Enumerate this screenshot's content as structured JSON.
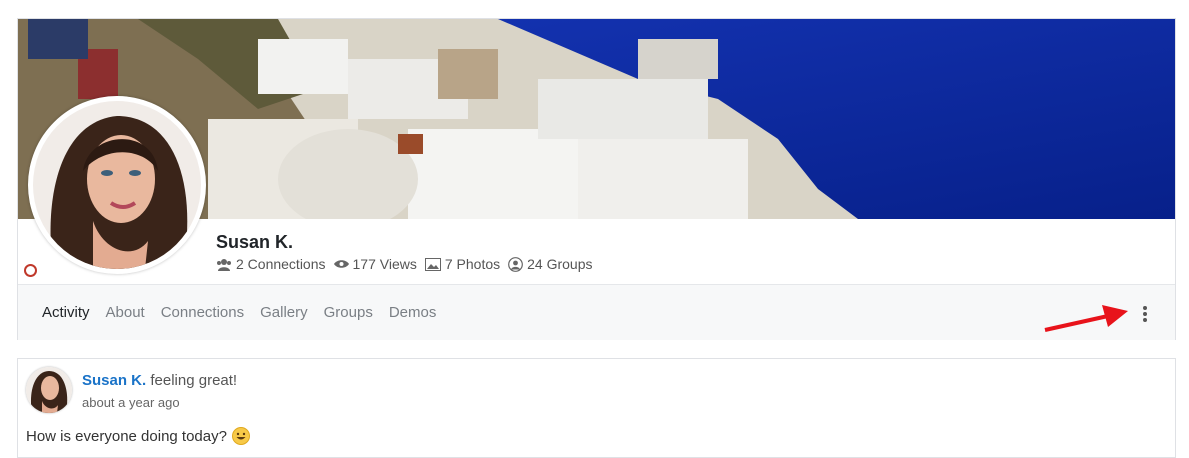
{
  "profile": {
    "name": "Susan K.",
    "stats": {
      "connections": "2 Connections",
      "views": "177 Views",
      "photos": "7 Photos",
      "groups": "24 Groups"
    }
  },
  "tabs": [
    {
      "label": "Activity",
      "active": true
    },
    {
      "label": "About"
    },
    {
      "label": "Connections"
    },
    {
      "label": "Gallery"
    },
    {
      "label": "Groups"
    },
    {
      "label": "Demos"
    }
  ],
  "post": {
    "author": "Susan K.",
    "action": "feeling great!",
    "time": "about a year ago",
    "text": "How is everyone doing today?",
    "emoji": "smile-emoji"
  },
  "colors": {
    "sea": "#0a2a9a",
    "link": "#1a73c8",
    "status_dot": "#c0392b",
    "arrow": "#e8131b"
  }
}
